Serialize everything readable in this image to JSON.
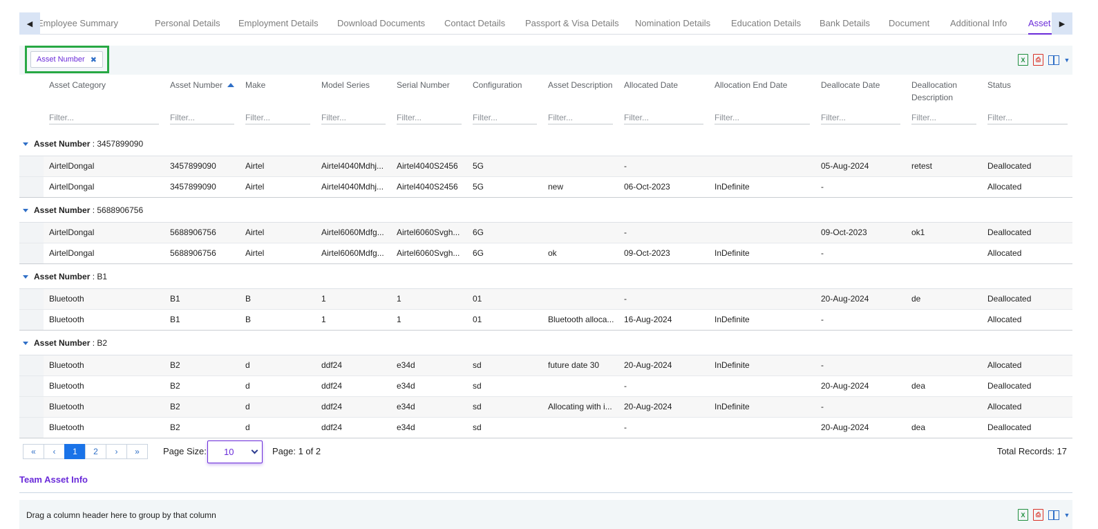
{
  "tabs": [
    {
      "label": "Employee Summary",
      "active": false
    },
    {
      "label": "Personal Details",
      "active": false
    },
    {
      "label": "Employment Details",
      "active": false
    },
    {
      "label": "Download Documents",
      "active": false
    },
    {
      "label": "Contact Details",
      "active": false
    },
    {
      "label": "Passport & Visa Details",
      "active": false
    },
    {
      "label": "Nomination Details",
      "active": false
    },
    {
      "label": "Education Details",
      "active": false
    },
    {
      "label": "Bank Details",
      "active": false
    },
    {
      "label": "Document",
      "active": false
    },
    {
      "label": "Additional Info",
      "active": false
    },
    {
      "label": "Asset Info",
      "active": true
    }
  ],
  "icons": {
    "scroll_left": "◀",
    "scroll_right": "▶",
    "chip_remove": "✖",
    "excel": "X",
    "pdf": "⎙",
    "caret": "▼"
  },
  "asset_grid": {
    "group_chip": "Asset Number",
    "columns": [
      "Asset Category",
      "Asset Number",
      "Make",
      "Model Series",
      "Serial Number",
      "Configuration",
      "Asset Description",
      "Allocated Date",
      "Allocation End Date",
      "Deallocate Date",
      "Deallocation Description",
      "Status"
    ],
    "sorted_column": "Asset Number",
    "sort_direction": "ascending",
    "filter_placeholder": "Filter...",
    "group_label": "Asset Number",
    "groups": [
      {
        "value": "3457899090",
        "rows": [
          [
            "AirtelDongal",
            "3457899090",
            "Airtel",
            "Airtel4040Mdhj...",
            "Airtel4040S2456",
            "5G",
            "",
            "-",
            "",
            "05-Aug-2024",
            "retest",
            "Deallocated"
          ],
          [
            "AirtelDongal",
            "3457899090",
            "Airtel",
            "Airtel4040Mdhj...",
            "Airtel4040S2456",
            "5G",
            "new",
            "06-Oct-2023",
            "InDefinite",
            "-",
            "",
            "Allocated"
          ]
        ]
      },
      {
        "value": "5688906756",
        "rows": [
          [
            "AirtelDongal",
            "5688906756",
            "Airtel",
            "Airtel6060Mdfg...",
            "Airtel6060Svgh...",
            "6G",
            "",
            "-",
            "",
            "09-Oct-2023",
            "ok1",
            "Deallocated"
          ],
          [
            "AirtelDongal",
            "5688906756",
            "Airtel",
            "Airtel6060Mdfg...",
            "Airtel6060Svgh...",
            "6G",
            "ok",
            "09-Oct-2023",
            "InDefinite",
            "-",
            "",
            "Allocated"
          ]
        ]
      },
      {
        "value": "B1",
        "rows": [
          [
            "Bluetooth",
            "B1",
            "B",
            "1",
            "1",
            "01",
            "",
            "-",
            "",
            "20-Aug-2024",
            "de",
            "Deallocated"
          ],
          [
            "Bluetooth",
            "B1",
            "B",
            "1",
            "1",
            "01",
            "Bluetooth alloca...",
            "16-Aug-2024",
            "InDefinite",
            "-",
            "",
            "Allocated"
          ]
        ]
      },
      {
        "value": "B2",
        "rows": [
          [
            "Bluetooth",
            "B2",
            "d",
            "ddf24",
            "e34d",
            "sd",
            "future date 30",
            "20-Aug-2024",
            "InDefinite",
            "-",
            "",
            "Allocated"
          ],
          [
            "Bluetooth",
            "B2",
            "d",
            "ddf24",
            "e34d",
            "sd",
            "",
            "-",
            "",
            "20-Aug-2024",
            "dea",
            "Deallocated"
          ],
          [
            "Bluetooth",
            "B2",
            "d",
            "ddf24",
            "e34d",
            "sd",
            "Allocating with i...",
            "20-Aug-2024",
            "InDefinite",
            "-",
            "",
            "Allocated"
          ],
          [
            "Bluetooth",
            "B2",
            "d",
            "ddf24",
            "e34d",
            "sd",
            "",
            "-",
            "",
            "20-Aug-2024",
            "dea",
            "Deallocated"
          ]
        ]
      }
    ]
  },
  "pager": {
    "first": "«",
    "prev": "‹",
    "pages": [
      "1",
      "2"
    ],
    "current_page": "1",
    "next": "›",
    "last": "»",
    "page_size_label": "Page Size:",
    "page_size": "10",
    "page_info": "Page: 1 of 2",
    "total_records": "Total Records: 17"
  },
  "team_section": {
    "title": "Team Asset Info",
    "group_hint": "Drag a column header here to group by that column"
  },
  "colors": {
    "accent": "#6a2bd9",
    "link_blue": "#2f6fc7",
    "active_page": "#1a73e8",
    "highlight_box": "#27a844",
    "panel_bg": "#f2f6f8"
  }
}
